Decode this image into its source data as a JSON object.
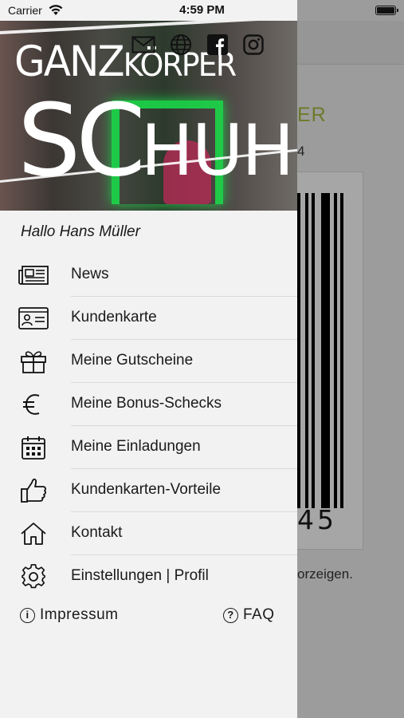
{
  "status_bar": {
    "carrier": "Carrier",
    "time": "4:59 PM"
  },
  "header": {
    "logo_line1_big": "GANZ",
    "logo_line1_small": "KÖRPER",
    "logo_line2_big": "SC",
    "logo_line2_small": "HUH",
    "social_icons": [
      "mail-icon",
      "globe-icon",
      "facebook-icon",
      "instagram-icon"
    ]
  },
  "greeting": "Hallo Hans Müller",
  "menu": [
    {
      "label": "News",
      "icon": "newspaper-icon"
    },
    {
      "label": "Kundenkarte",
      "icon": "id-card-icon"
    },
    {
      "label": "Meine Gutscheine",
      "icon": "gift-icon"
    },
    {
      "label": "Meine Bonus-Schecks",
      "icon": "euro-icon"
    },
    {
      "label": "Meine Einladungen",
      "icon": "calendar-icon"
    },
    {
      "label": "Kundenkarten-Vorteile",
      "icon": "thumbs-up-icon"
    },
    {
      "label": "Kontakt",
      "icon": "home-icon"
    },
    {
      "label": "Einstellungen | Profil",
      "icon": "gear-icon"
    }
  ],
  "footer": {
    "impressum": "Impressum",
    "faq": "FAQ"
  },
  "background": {
    "title_fragment": "ER",
    "number_fragment": "4",
    "barcode_digits": "45",
    "note_fragment": "orzeigen."
  },
  "colors": {
    "drawer_bg": "#f2f2f2",
    "accent_green": "#9fb61f",
    "overlay": "#9c9c9c"
  }
}
